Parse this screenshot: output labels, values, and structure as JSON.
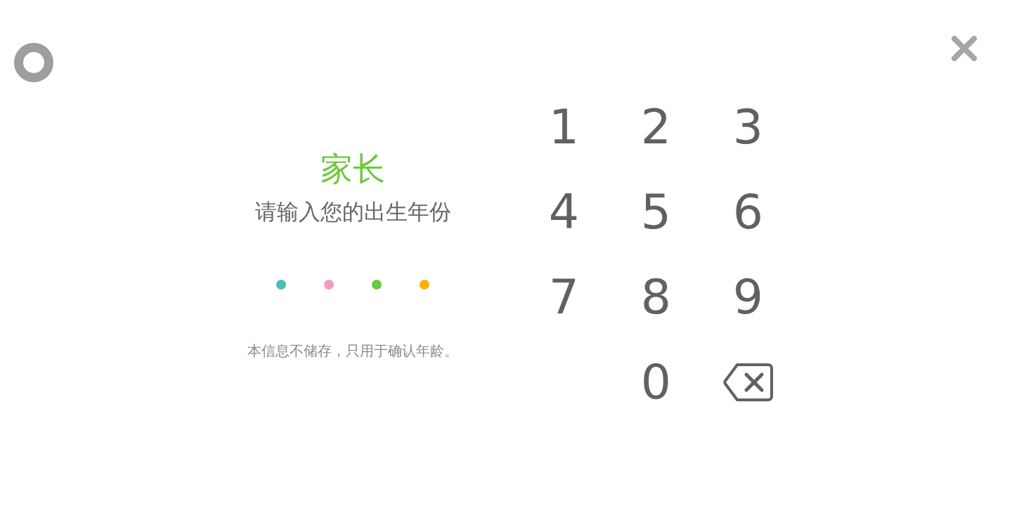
{
  "title": "家长",
  "prompt": "请输入您的出生年份",
  "pin_dots": [
    {
      "color": "#4bbfb5"
    },
    {
      "color": "#f79ac0"
    },
    {
      "color": "#6cc93a"
    },
    {
      "color": "#ffb000"
    }
  ],
  "note": "本信息不储存，只用于确认年龄。",
  "keypad": {
    "keys": [
      {
        "kind": "digit",
        "label": "1"
      },
      {
        "kind": "digit",
        "label": "2"
      },
      {
        "kind": "digit",
        "label": "3"
      },
      {
        "kind": "digit",
        "label": "4"
      },
      {
        "kind": "digit",
        "label": "5"
      },
      {
        "kind": "digit",
        "label": "6"
      },
      {
        "kind": "digit",
        "label": "7"
      },
      {
        "kind": "digit",
        "label": "8"
      },
      {
        "kind": "digit",
        "label": "9"
      },
      {
        "kind": "blank"
      },
      {
        "kind": "digit",
        "label": "0"
      },
      {
        "kind": "backspace"
      }
    ]
  }
}
